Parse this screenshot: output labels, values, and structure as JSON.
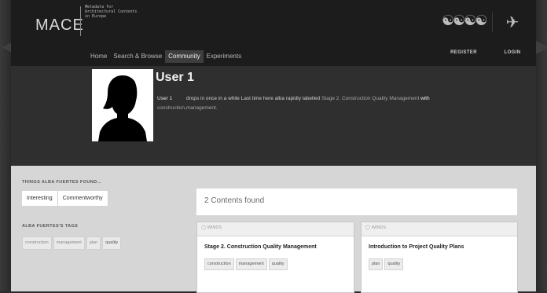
{
  "header": {
    "logo": "MACE",
    "tagline": [
      "Metadata for",
      "Architectural Contents",
      "in Europe"
    ],
    "nav": [
      "Home",
      "Search & Browse",
      "Community",
      "Experiments"
    ],
    "active_nav": "Community",
    "register_label": "REGISTER",
    "login_label": "LOGIN"
  },
  "profile": {
    "name": "User 1",
    "bio_label": "User 1",
    "bio_text": "drops in once in a while Last time here alba rapidly labelled",
    "bio_link": "Stage 2. Construction Quality Management",
    "bio_with": "with",
    "bio_tags": "construction,management."
  },
  "found": {
    "title": "THINGS ALBA FUERTES FOUND...",
    "tabs": [
      "Interesting",
      "Commentworthy"
    ]
  },
  "tags_section": {
    "title": "ALBA FUERTES'S TAGS",
    "tags": [
      "construction",
      "management",
      "plan",
      "quality"
    ]
  },
  "results": {
    "count_text": "2 Contents found",
    "cards": [
      {
        "source": "WINDS",
        "title": "Stage 2. Construction Quality Management",
        "tags": [
          "construction",
          "management",
          "quality"
        ]
      },
      {
        "source": "WINDS",
        "title": "Introduction to Project Quality Plans",
        "tags": [
          "plan",
          "quality"
        ]
      }
    ]
  }
}
